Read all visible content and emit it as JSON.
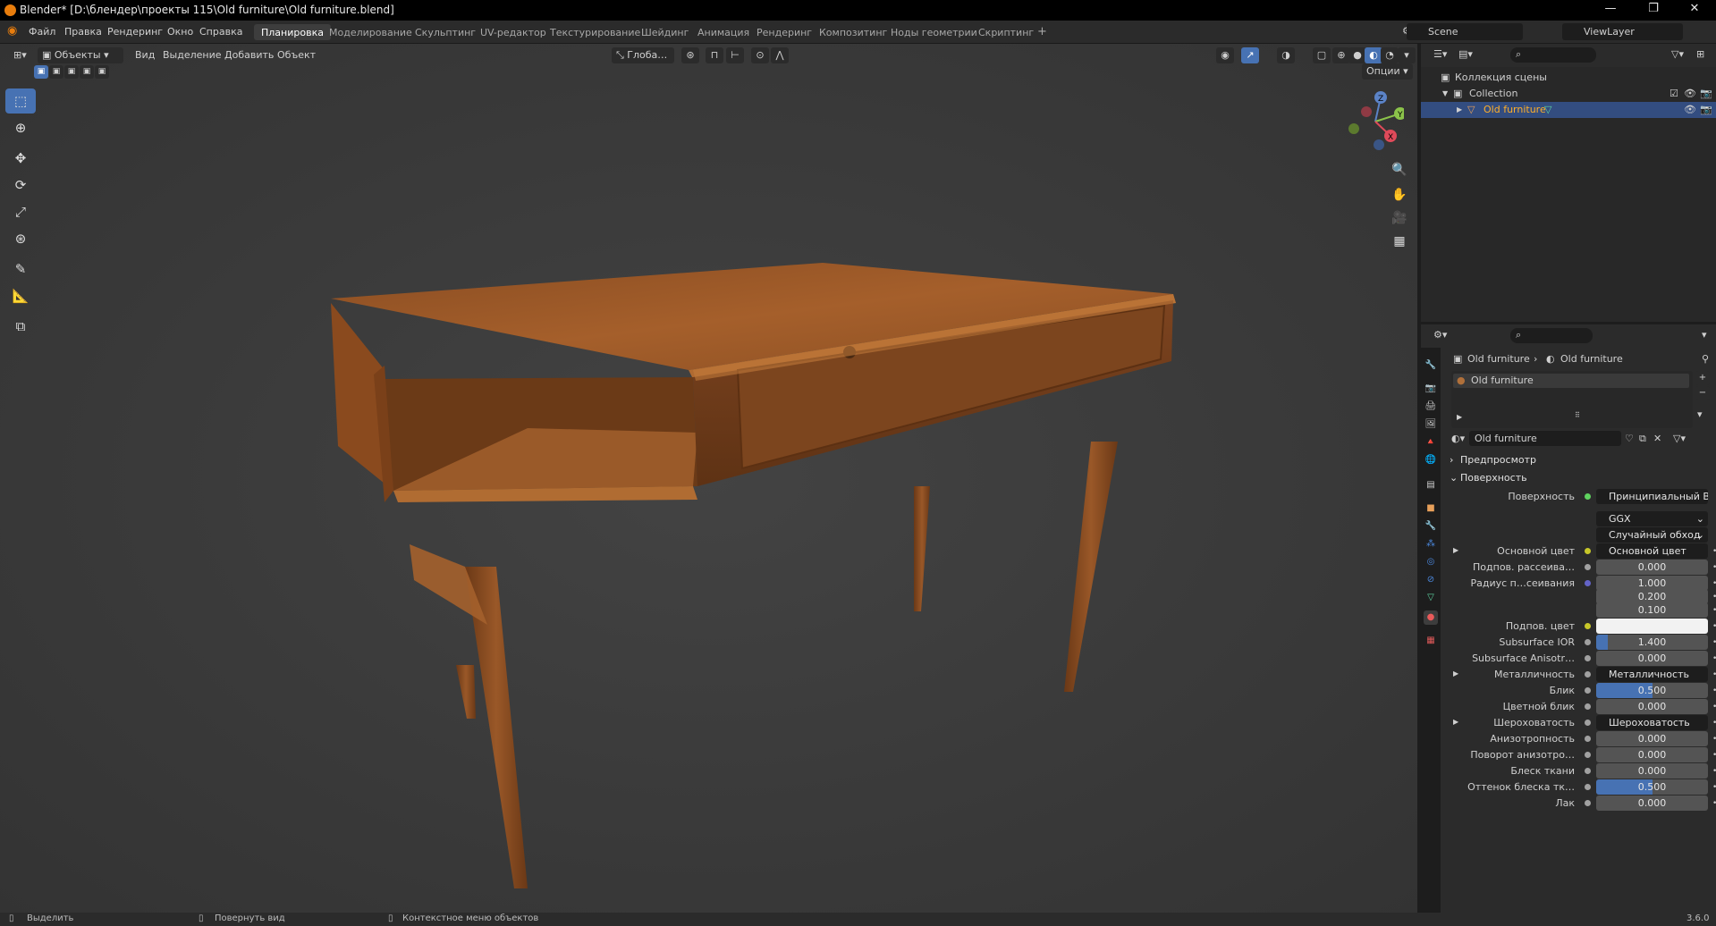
{
  "window": {
    "title": "Blender* [D:\\блендер\\проекты 115\\Old furniture\\Old furniture.blend]",
    "min": "—",
    "max": "❐",
    "close": "✕"
  },
  "menu": [
    "Файл",
    "Правка",
    "Рендеринг",
    "Окно",
    "Справка"
  ],
  "workspaces": [
    "Планировка",
    "Моделирование",
    "Скульптинг",
    "UV-редактор",
    "Текстурирование",
    "Шейдинг",
    "Анимация",
    "Рендеринг",
    "Композитинг",
    "Ноды геометрии",
    "Скриптинг"
  ],
  "active_workspace": "Планировка",
  "add_tab": "+",
  "scene": "Scene",
  "view_layer": "ViewLayer",
  "viewport": {
    "mode": "Объекты",
    "menus": [
      "Вид",
      "Выделение",
      "Добавить",
      "Объект"
    ],
    "orientation": "Глоба…",
    "options": "Опции",
    "gizmo": {
      "x": "X",
      "y": "Y",
      "z": "Z"
    }
  },
  "outliner": {
    "rows": [
      {
        "label": "Коллекция сцены"
      },
      {
        "label": "Collection"
      },
      {
        "label": "Old furniture",
        "selected": true
      }
    ]
  },
  "properties": {
    "breadcrumb": [
      "Old furniture",
      "Old furniture"
    ],
    "material_slot": "Old furniture",
    "material_name": "Old furniture",
    "sections": {
      "preview": "Предпросмотр",
      "surface": "Поверхность"
    },
    "surface_label": "Поверхность",
    "surface_value": "Принципиальный BSDF",
    "distribution": "GGX",
    "subsurface_method": "Случайный обход",
    "rows": [
      {
        "label": "Основной цвет",
        "type": "link",
        "value": "Основной цвет",
        "sock": "#c7c729"
      },
      {
        "label": "Подпов. рассеива…",
        "type": "num",
        "value": "0.000",
        "sock": "#a1a1a1"
      },
      {
        "label": "Радиус п…сеивания",
        "type": "num",
        "value": "1.000",
        "sock": "#6363c7"
      },
      {
        "label": "",
        "type": "num",
        "value": "0.200"
      },
      {
        "label": "",
        "type": "num",
        "value": "0.100"
      },
      {
        "label": "Подпов. цвет",
        "type": "color",
        "value": "",
        "sock": "#c7c729"
      },
      {
        "label": "Subsurface IOR",
        "type": "num",
        "value": "1.400",
        "fill": 0.1,
        "sock": "#a1a1a1"
      },
      {
        "label": "Subsurface Anisotr…",
        "type": "num",
        "value": "0.000",
        "sock": "#a1a1a1"
      },
      {
        "label": "Металличность",
        "type": "link",
        "value": "Металличность",
        "sock": "#a1a1a1"
      },
      {
        "label": "Блик",
        "type": "num",
        "value": "0.500",
        "fill": 0.5,
        "sock": "#a1a1a1"
      },
      {
        "label": "Цветной блик",
        "type": "num",
        "value": "0.000",
        "sock": "#a1a1a1"
      },
      {
        "label": "Шероховатость",
        "type": "link",
        "value": "Шероховатость",
        "sock": "#a1a1a1"
      },
      {
        "label": "Анизотропность",
        "type": "num",
        "value": "0.000",
        "sock": "#a1a1a1"
      },
      {
        "label": "Поворот анизотро…",
        "type": "num",
        "value": "0.000",
        "sock": "#a1a1a1"
      },
      {
        "label": "Блеск ткани",
        "type": "num",
        "value": "0.000",
        "sock": "#a1a1a1"
      },
      {
        "label": "Оттенок блеска тк…",
        "type": "num",
        "value": "0.500",
        "fill": 0.5,
        "sock": "#a1a1a1"
      },
      {
        "label": "Лак",
        "type": "num",
        "value": "0.000",
        "sock": "#a1a1a1"
      }
    ]
  },
  "status": {
    "select": "Выделить",
    "rotate": "Повернуть вид",
    "context": "Контекстное меню объектов",
    "version": "3.6.0"
  },
  "colors": {
    "accent": "#4772b3",
    "wood_light": "#a8652e",
    "wood_dark": "#6b3a17"
  }
}
